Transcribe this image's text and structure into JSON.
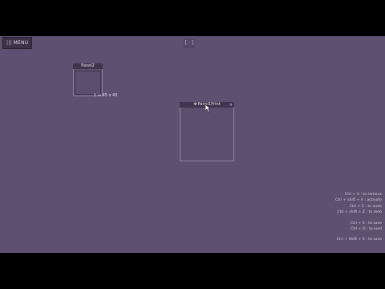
{
  "toolbar": {
    "menu_icon": "menu-bars-icon",
    "menu_label": "MENU",
    "indicator_text": "[ · ]"
  },
  "panels": [
    {
      "title": "Panel2"
    },
    {
      "title": "Panel1Print",
      "move_icon": "move-icon",
      "close_icon": "close-icon"
    }
  ],
  "resize_readout": "↕ ↔ 45 x 40",
  "help": {
    "lines": [
      "Ctrl + X : to remove",
      "Ctrl + shift + A : activate",
      "Ctrl + Z : to undo",
      "Ctrl + shift + Z : to redo",
      "",
      "Ctrl + S : to save",
      "Ctrl + O : to load",
      "",
      "Ctrl + Shift + S : to save"
    ]
  },
  "colors": {
    "workspace": "#5e5070",
    "panel_border": "#8a7aa6",
    "titlebar": "#40354e",
    "letterbox": "#000000"
  }
}
